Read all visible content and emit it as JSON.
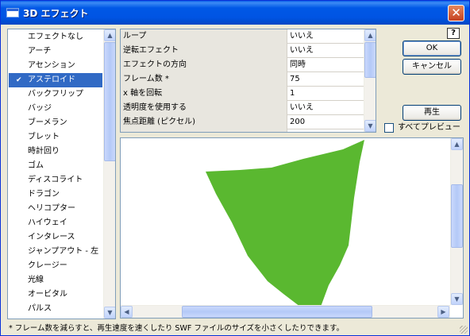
{
  "window": {
    "title": "3D エフェクト",
    "close_glyph": "✕",
    "help_glyph": "?"
  },
  "effects": {
    "items": [
      {
        "label": "エフェクトなし",
        "selected": false
      },
      {
        "label": "アーチ",
        "selected": false
      },
      {
        "label": "アセンション",
        "selected": false
      },
      {
        "label": "アステロイド",
        "selected": true
      },
      {
        "label": "バックフリップ",
        "selected": false
      },
      {
        "label": "バッジ",
        "selected": false
      },
      {
        "label": "ブーメラン",
        "selected": false
      },
      {
        "label": "ブレット",
        "selected": false
      },
      {
        "label": "時計回り",
        "selected": false
      },
      {
        "label": "ゴム",
        "selected": false
      },
      {
        "label": "ディスコライト",
        "selected": false
      },
      {
        "label": "ドラゴン",
        "selected": false
      },
      {
        "label": "ヘリコプター",
        "selected": false
      },
      {
        "label": "ハイウェイ",
        "selected": false
      },
      {
        "label": "インタレース",
        "selected": false
      },
      {
        "label": "ジャンプアウト - 左",
        "selected": false
      },
      {
        "label": "クレージー",
        "selected": false
      },
      {
        "label": "光線",
        "selected": false
      },
      {
        "label": "オービタル",
        "selected": false
      },
      {
        "label": "パルス",
        "selected": false
      }
    ],
    "check_glyph": "✔"
  },
  "properties": [
    {
      "name": "ループ",
      "value": "いいえ"
    },
    {
      "name": "逆転エフェクト",
      "value": "いいえ"
    },
    {
      "name": "エフェクトの方向",
      "value": "同時"
    },
    {
      "name": "フレーム数 *",
      "value": "75"
    },
    {
      "name": "x 軸を回転",
      "value": "1"
    },
    {
      "name": "透明度を使用する",
      "value": "いいえ"
    },
    {
      "name": "焦点距離 (ピクセル)",
      "value": "200"
    }
  ],
  "buttons": {
    "ok": "OK",
    "cancel": "キャンセル",
    "play": "再生"
  },
  "preview_all": {
    "label": "すべてプレビュー",
    "checked": false
  },
  "status_text": "* フレーム数を減らすと、再生速度を速くしたり SWF ファイルのサイズを小さくしたりできます。",
  "colors": {
    "selection": "#316ac5",
    "shape_fill": "#5ab830",
    "title_bar": "#0054e3"
  },
  "scroll_glyphs": {
    "up": "▲",
    "down": "▼",
    "left": "◀",
    "right": "▶"
  }
}
